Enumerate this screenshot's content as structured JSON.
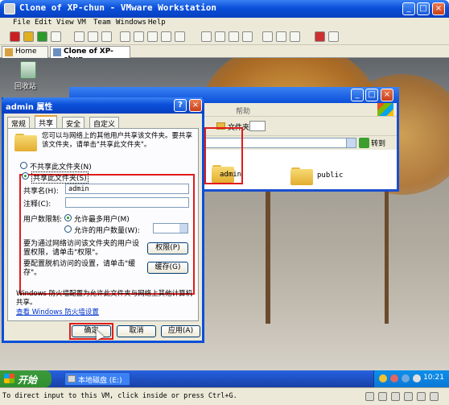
{
  "vmware": {
    "title": "Clone of XP-chun - VMware Workstation",
    "menu": [
      "File",
      "Edit",
      "View",
      "VM",
      "Team",
      "Windows",
      "Help"
    ],
    "tabs": [
      {
        "label": "Home",
        "icon": "home-icon"
      },
      {
        "label": "Clone of XP-chun",
        "icon": "vm-icon"
      }
    ],
    "status_text": "To direct input to this VM, click inside or press Ctrl+G."
  },
  "desktop": {
    "recycle_bin_label": "回收站"
  },
  "explorer": {
    "help_menu": "帮助",
    "folders_button": "文件夹",
    "go_button": "转到",
    "folders": [
      {
        "name": "admin",
        "icon": "folder-icon"
      },
      {
        "name": "public",
        "icon": "folder-icon"
      }
    ]
  },
  "dialog": {
    "title": "admin 属性",
    "tabs": [
      "常规",
      "共享",
      "安全",
      "自定义"
    ],
    "active_tab": "共享",
    "info_text": "您可以与网络上的其他用户共享该文件夹。要共享该文件夹，请单击\"共享此文件夹\"。",
    "no_share_label": "不共享此文件夹(N)",
    "share_label": "共享此文件夹(S)",
    "share_name_label": "共享名(H):",
    "share_name_value": "admin",
    "comment_label": "注释(C):",
    "comment_value": "",
    "user_limit_label": "用户数限制:",
    "max_users_label": "允许最多用户(M)",
    "allowed_users_label": "允许的用户数量(W):",
    "permissions_text": "要为通过网络访问该文件夹的用户设置权限，请单击\"权限\"。",
    "permissions_button": "权限(P)",
    "cache_text": "要配置脱机访问的设置，请单击\"缓存\"。",
    "cache_button": "缓存(G)",
    "firewall_text": "Windows 防火墙配置为允许此文件夹与网络上其他计算机共享。",
    "firewall_link": "查看 Windows 防火墙设置",
    "ok_button": "确定",
    "cancel_button": "取消",
    "apply_button": "应用(A)"
  },
  "taskbar": {
    "start_label": "开始",
    "task_label": "本地磁盘 (E:)",
    "clock": "10:21"
  },
  "colors": {
    "xp_blue": "#0a4fd8",
    "highlight_red": "#e01b1b",
    "start_green": "#2f8f2f"
  }
}
